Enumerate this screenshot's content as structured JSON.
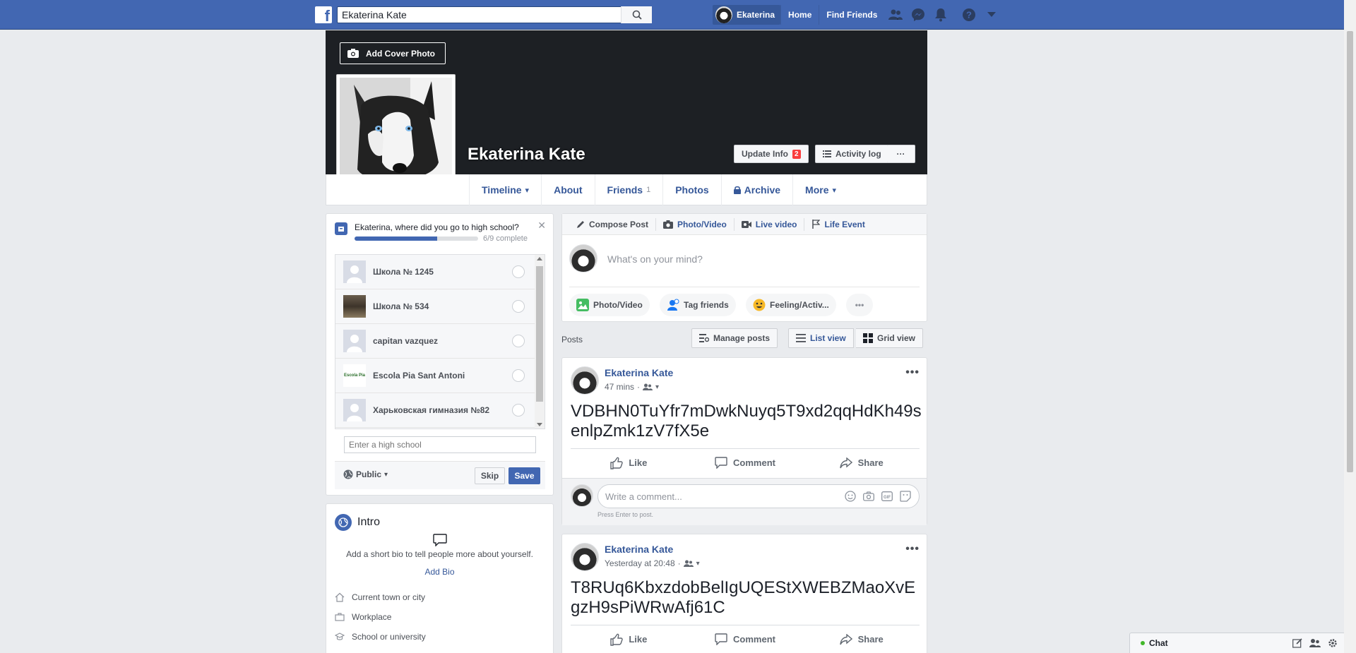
{
  "topbar": {
    "search_value": "Ekaterina Kate",
    "user_name": "Ekaterina",
    "links": [
      "Home",
      "Find Friends"
    ],
    "icons": [
      "friend-requests-icon",
      "messenger-icon",
      "notifications-icon",
      "help-icon",
      "account-menu-icon"
    ]
  },
  "profile": {
    "name": "Ekaterina Kate",
    "add_cover": "Add Cover Photo",
    "update_info": "Update Info",
    "update_info_badge": "2",
    "activity_log": "Activity log",
    "more_dots": "···"
  },
  "tabs": [
    {
      "label": "Timeline",
      "caret": "▾"
    },
    {
      "label": "About"
    },
    {
      "label": "Friends",
      "count": "1"
    },
    {
      "label": "Photos"
    },
    {
      "label": "Archive",
      "lock": true
    },
    {
      "label": "More",
      "caret": "▾"
    }
  ],
  "high_school": {
    "question": "Ekaterina, where did you go to high school?",
    "progress": 0.667,
    "complete_text": "6/9 complete",
    "schools": [
      "Школа № 1245",
      "Школа № 534",
      "capitan vazquez",
      "Escola Pia Sant Antoni",
      "Харьковская гимназия №82"
    ],
    "input_placeholder": "Enter a high school",
    "privacy": "Public",
    "skip": "Skip",
    "save": "Save",
    "thumb_text": "Escola Pia"
  },
  "intro": {
    "title": "Intro",
    "bio_prompt": "Add a short bio to tell people more about yourself.",
    "add_bio": "Add Bio",
    "rows": [
      "Current town or city",
      "Workplace",
      "School or university"
    ]
  },
  "compose": {
    "tabs": [
      "Compose Post",
      "Photo/Video",
      "Live video",
      "Life Event"
    ],
    "placeholder": "What's on your mind?",
    "chips": [
      "Photo/Video",
      "Tag friends",
      "Feeling/Activ..."
    ],
    "more": "•••"
  },
  "posts_bar": {
    "label": "Posts",
    "manage": "Manage posts",
    "list_view": "List view",
    "grid_view": "Grid view"
  },
  "posts": [
    {
      "author": "Ekaterina Kate",
      "time": "47 mins",
      "text": "VDBHN0TuYfr7mDwkNuyq5T9xd2qqHdKh49senlpZmk1zV7fX5e"
    },
    {
      "author": "Ekaterina Kate",
      "time": "Yesterday at 20:48",
      "text": "T8RUq6KbxzdobBelIgUQEStXWEBZMaoXvEgzH9sPiWRwAfj61C"
    }
  ],
  "post_actions": {
    "like": "Like",
    "comment": "Comment",
    "share": "Share"
  },
  "comment": {
    "placeholder": "Write a comment...",
    "hint": "Press Enter to post."
  },
  "chat": {
    "label": "Chat"
  },
  "colors": {
    "brand": "#4267b2",
    "link": "#365899",
    "bg": "#e9ebee"
  }
}
